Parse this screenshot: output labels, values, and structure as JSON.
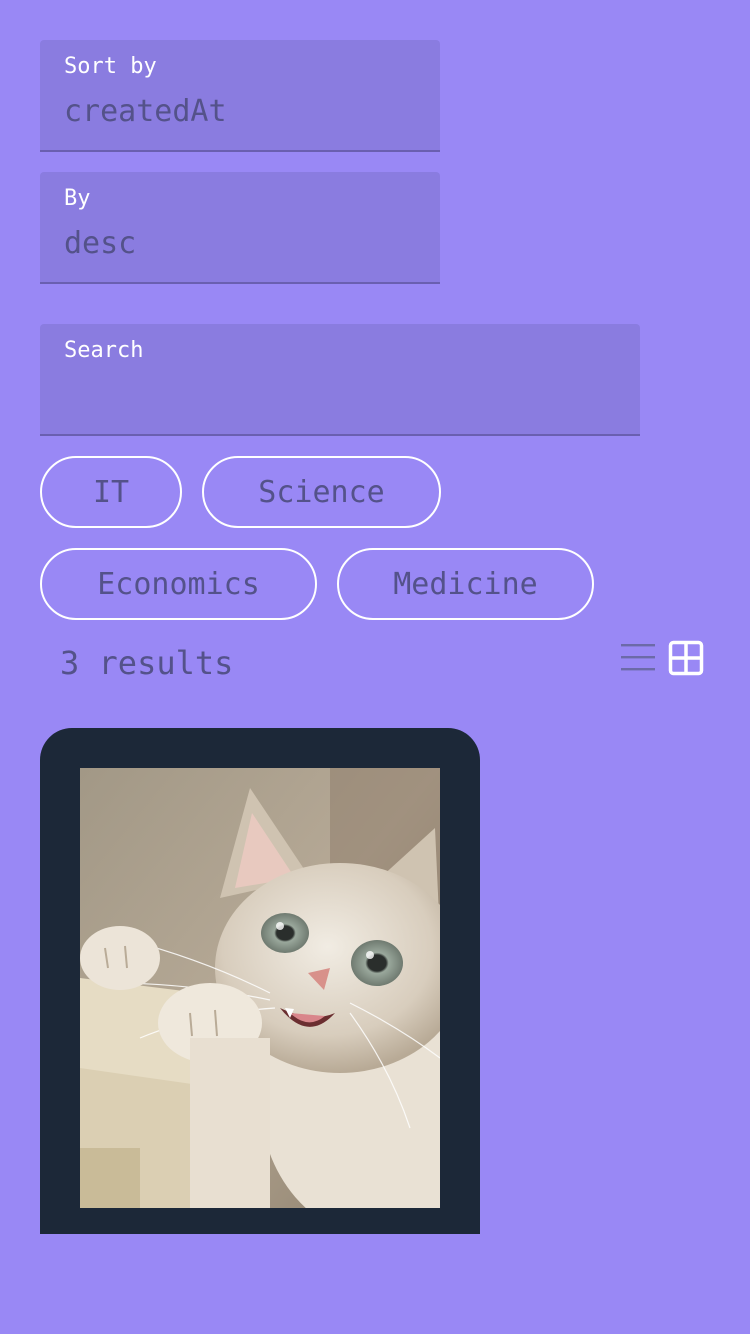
{
  "filters": {
    "sort_label": "Sort by",
    "sort_value": "createdAt",
    "order_label": "By",
    "order_value": "desc",
    "search_label": "Search",
    "search_value": ""
  },
  "categories": [
    {
      "label": "IT"
    },
    {
      "label": "Science"
    },
    {
      "label": "Economics"
    },
    {
      "label": "Medicine"
    }
  ],
  "results": {
    "count_text": "3 results"
  },
  "view_toggle": {
    "list_icon": "list-view-icon",
    "grid_icon": "grid-view-icon",
    "active": "grid"
  },
  "cards": [
    {
      "image": "kitten-photo"
    }
  ],
  "colors": {
    "background": "#9988f5",
    "field_bg": "#8a7ce0",
    "text_muted": "#54528a",
    "card_bg": "#1c2838",
    "white": "#ffffff"
  }
}
